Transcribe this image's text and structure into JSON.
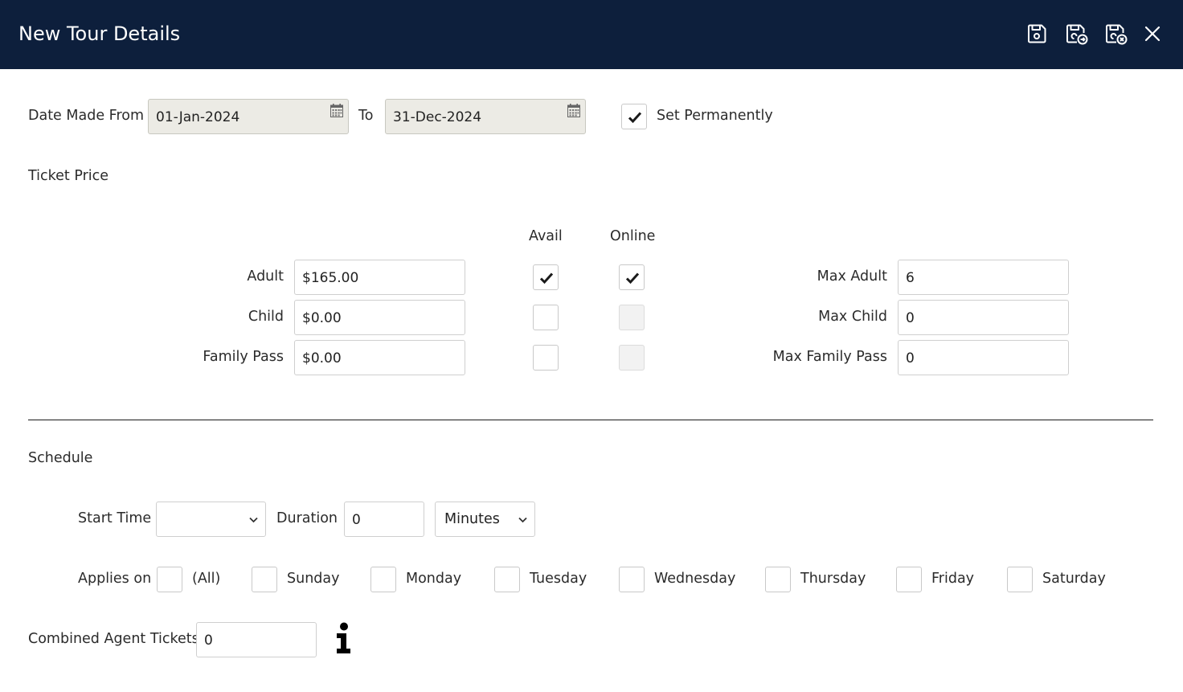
{
  "header": {
    "title": "New Tour Details",
    "icons": [
      "save-icon",
      "save-and-new-icon",
      "save-and-close-icon",
      "close-icon"
    ]
  },
  "dates": {
    "from_label": "Date Made From",
    "from_value": "01-Jan-2024",
    "to_label": "To",
    "to_value": "31-Dec-2024",
    "set_permanently_label": "Set Permanently",
    "set_permanently_checked": true
  },
  "ticket_price": {
    "section_label": "Ticket Price",
    "avail_header": "Avail",
    "online_header": "Online",
    "rows": [
      {
        "label": "Adult",
        "price": "$165.00",
        "avail": true,
        "online": true,
        "max_label": "Max Adult",
        "max_value": "6"
      },
      {
        "label": "Child",
        "price": "$0.00",
        "avail": false,
        "online": false,
        "max_label": "Max Child",
        "max_value": "0"
      },
      {
        "label": "Family Pass",
        "price": "$0.00",
        "avail": false,
        "online": false,
        "max_label": "Max Family Pass",
        "max_value": "0"
      }
    ]
  },
  "schedule": {
    "section_label": "Schedule",
    "start_time_label": "Start Time",
    "start_time_value": "",
    "duration_label": "Duration",
    "duration_value": "0",
    "duration_unit": "Minutes",
    "applies_on_label": "Applies on",
    "days": [
      "(All)",
      "Sunday",
      "Monday",
      "Tuesday",
      "Wednesday",
      "Thursday",
      "Friday",
      "Saturday"
    ]
  },
  "combined": {
    "label": "Combined Agent Tickets",
    "value": "0",
    "info_icon": "info-icon"
  },
  "colors": {
    "header_bg": "#0d1f3c",
    "date_field_bg": "#ecebe5"
  }
}
